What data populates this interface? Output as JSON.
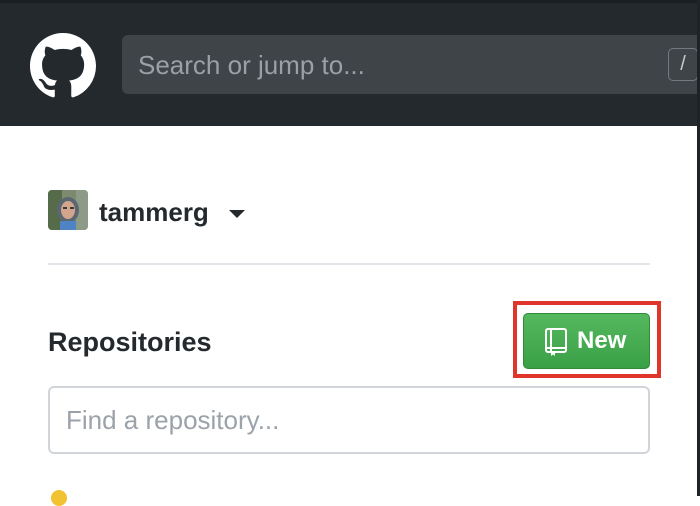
{
  "header": {
    "logo_icon": "github-octocat-icon",
    "search_placeholder": "Search or jump to...",
    "search_shortcut": "/"
  },
  "user": {
    "username": "tammerg",
    "avatar_icon": "user-avatar"
  },
  "repositories": {
    "title": "Repositories",
    "new_button_label": "New",
    "new_button_icon": "repo-book-icon",
    "find_placeholder": "Find a repository..."
  },
  "colors": {
    "header_bg": "#24292e",
    "new_button_green": "#4caf50",
    "highlight_red": "#e0352b"
  }
}
